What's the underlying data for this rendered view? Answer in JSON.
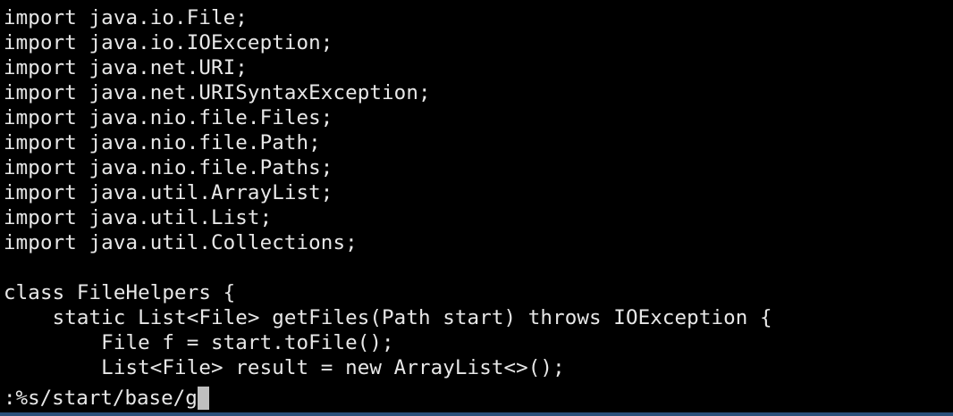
{
  "editor": {
    "lines": [
      "import java.io.File;",
      "import java.io.IOException;",
      "import java.net.URI;",
      "import java.net.URISyntaxException;",
      "import java.nio.file.Files;",
      "import java.nio.file.Path;",
      "import java.nio.file.Paths;",
      "import java.util.ArrayList;",
      "import java.util.List;",
      "import java.util.Collections;",
      "",
      "class FileHelpers {",
      "    static List<File> getFiles(Path start) throws IOException {",
      "        File f = start.toFile();",
      "        List<File> result = new ArrayList<>();"
    ],
    "command": ":%s/start/base/g"
  },
  "colors": {
    "background": "#000000",
    "text": "#e8e8e8",
    "cursor": "#bfbfbf",
    "bottom_strip": "#2a4f7a"
  }
}
